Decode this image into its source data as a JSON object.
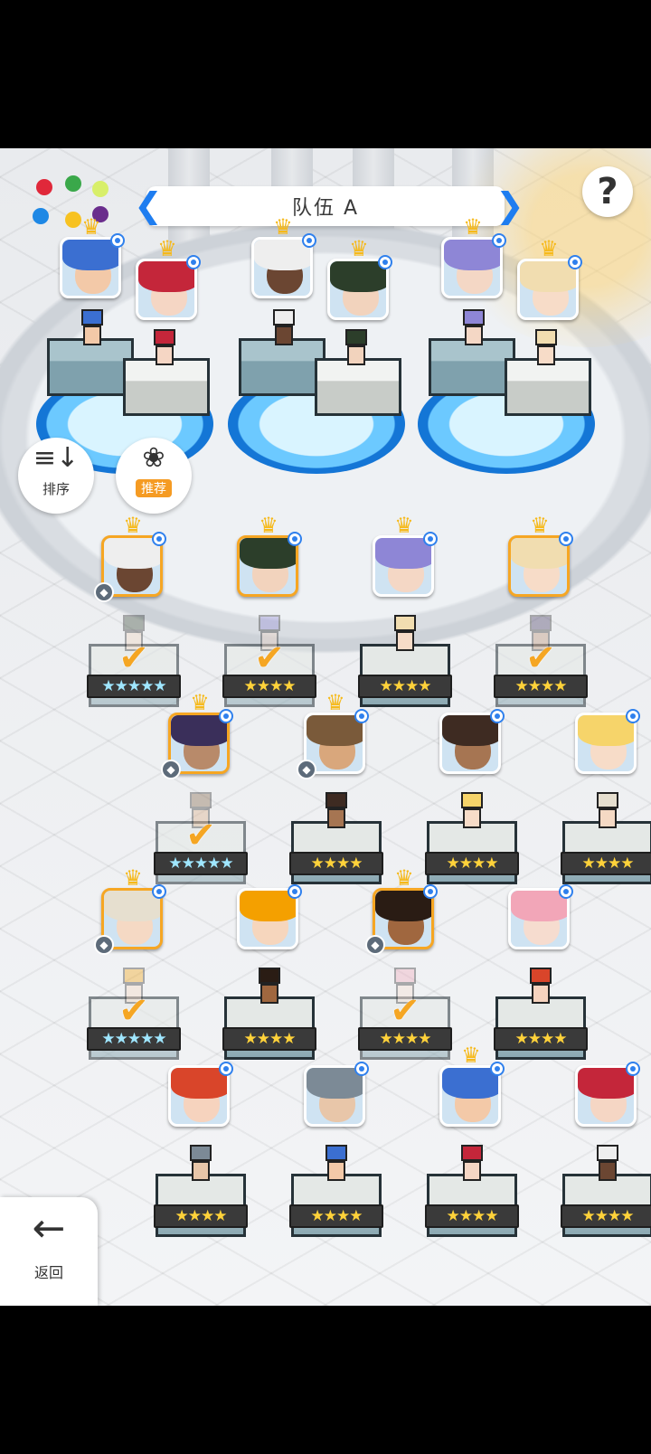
{
  "header": {
    "team_title": "队伍 A",
    "prev_arrow": "❮",
    "next_arrow": "❯"
  },
  "help": {
    "label": "?"
  },
  "buttons": {
    "sort_label": "排序",
    "sort_icon": "≡↓",
    "recommend_label": "推荐",
    "recommend_icon": "❀",
    "back_label": "返回",
    "back_icon": "←"
  },
  "elements": [
    "fire",
    "wind",
    "light",
    "water",
    "thunder",
    "dark"
  ],
  "colors": {
    "accent": "#1e7df0",
    "gold": "#f6a623",
    "water_pad": "#1476d6"
  },
  "team_slots": [
    {
      "front": "blue-hair",
      "back": "red-hair"
    },
    {
      "front": "white-hair",
      "back": "green-masked"
    },
    {
      "front": "lavender-hair",
      "back": "blonde-hair"
    }
  ],
  "roster": [
    {
      "stars": "★★★★★",
      "selected": true,
      "rainbow": true
    },
    {
      "stars": "★★★★",
      "selected": true,
      "rainbow": false
    },
    {
      "stars": "★★★★",
      "selected": false,
      "rainbow": false
    },
    {
      "stars": "★★★★",
      "selected": true,
      "rainbow": false
    },
    {
      "stars": "★★★★★",
      "selected": true,
      "rainbow": true
    },
    {
      "stars": "★★★★",
      "selected": false,
      "rainbow": false
    },
    {
      "stars": "★★★★",
      "selected": false,
      "rainbow": false
    },
    {
      "stars": "★★★★",
      "selected": false,
      "rainbow": false
    },
    {
      "stars": "★★★★★",
      "selected": true,
      "rainbow": true
    },
    {
      "stars": "★★★★",
      "selected": false,
      "rainbow": false
    },
    {
      "stars": "★★★★",
      "selected": true,
      "rainbow": false
    },
    {
      "stars": "★★★★",
      "selected": false,
      "rainbow": false
    },
    {
      "stars": "★★★★",
      "selected": false,
      "rainbow": false
    },
    {
      "stars": "★★★★",
      "selected": false,
      "rainbow": false
    },
    {
      "stars": "★★★★",
      "selected": false,
      "rainbow": false
    },
    {
      "stars": "★★★★",
      "selected": false,
      "rainbow": false
    }
  ],
  "check_mark": "✔",
  "crown_glyph": "♛"
}
